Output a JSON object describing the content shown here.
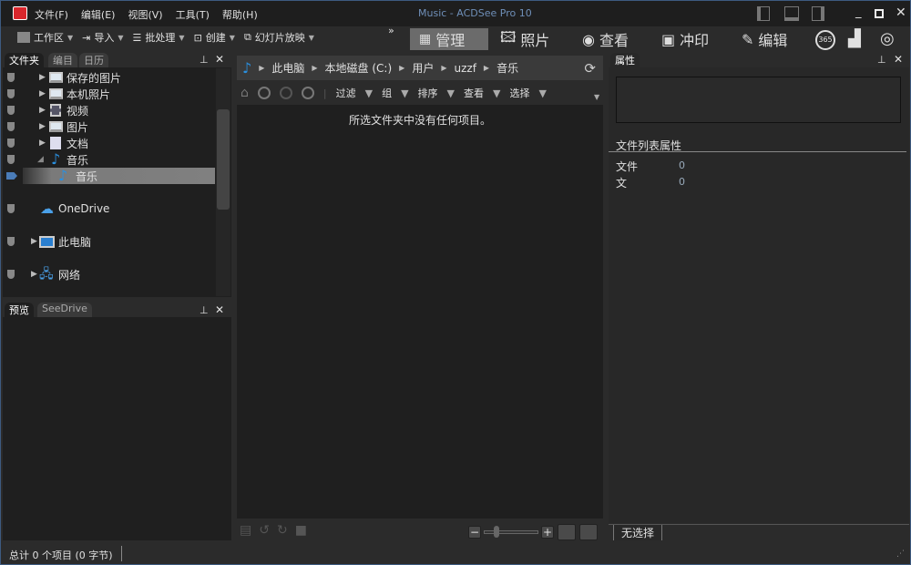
{
  "window": {
    "title": "Music - ACDSee Pro 10",
    "menu": [
      "文件(F)",
      "编辑(E)",
      "视图(V)",
      "工具(T)",
      "帮助(H)"
    ]
  },
  "toolbar": {
    "items": [
      "工作区",
      "导入",
      "批处理",
      "创建",
      "幻灯片放映"
    ],
    "overflow": "»"
  },
  "modes": [
    {
      "label": "管理",
      "icon": "grid-icon",
      "active": true
    },
    {
      "label": "照片",
      "icon": "photos-icon"
    },
    {
      "label": "查看",
      "icon": "eye-icon"
    },
    {
      "label": "冲印",
      "icon": "develop-icon"
    },
    {
      "label": "编辑",
      "icon": "edit-tools-icon"
    }
  ],
  "mode_icons": {
    "m365": "365"
  },
  "folders_panel": {
    "tabs": [
      "文件夹",
      "编目",
      "日历"
    ],
    "tree": [
      "保存的图片",
      "本机照片",
      "视频",
      "图片",
      "文档",
      "音乐"
    ],
    "selected": "音乐",
    "onedrive": "OneDrive",
    "pc": "此电脑",
    "network": "网络"
  },
  "preview_panel": {
    "tabs": [
      "预览",
      "SeeDrive"
    ]
  },
  "address": {
    "crumbs": [
      "此电脑",
      "本地磁盘 (C:)",
      "用户",
      "uzzf",
      "音乐"
    ]
  },
  "filter_bar": [
    "过滤",
    "组",
    "排序",
    "查看",
    "选择"
  ],
  "content": {
    "empty_message": "所选文件夹中没有任何项目。"
  },
  "properties": {
    "tab": "属性",
    "section": "文件列表属性",
    "rows": [
      {
        "label": "文件",
        "value": "0"
      },
      {
        "label": "文",
        "value": "0"
      }
    ],
    "bottom_tab": "无选择"
  },
  "status": {
    "text": "总计 0 个项目 (0 字节)"
  },
  "colors": {
    "accent": "#2a90e0",
    "titlebar": "#1e1e1e",
    "border": "#3d5a80"
  }
}
